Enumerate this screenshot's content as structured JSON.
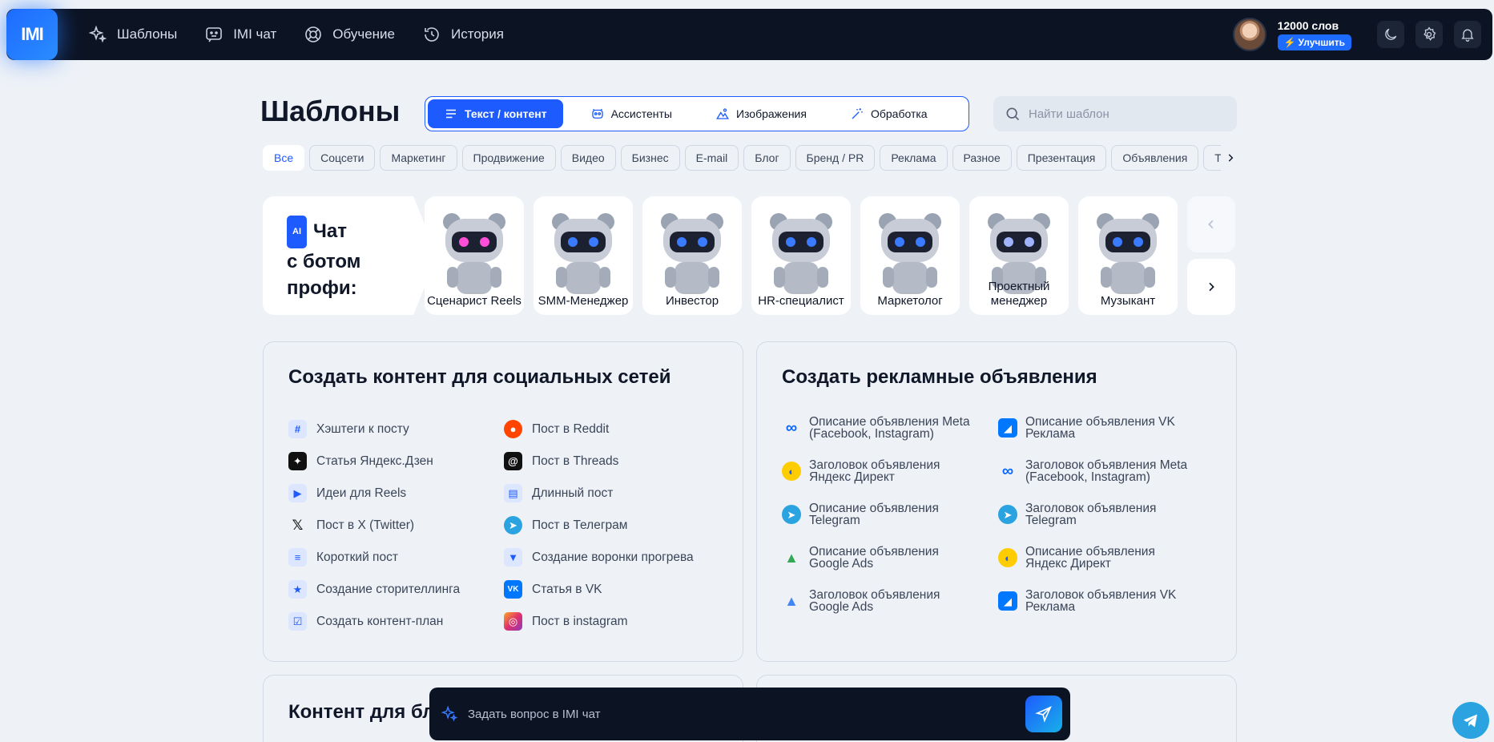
{
  "topbar": {
    "logo": "IMI",
    "nav": [
      {
        "label": "Шаблоны",
        "icon": "sparkles-icon"
      },
      {
        "label": "IMI чат",
        "icon": "chat-bot-icon"
      },
      {
        "label": "Обучение",
        "icon": "lifebuoy-icon"
      },
      {
        "label": "История",
        "icon": "history-icon"
      }
    ],
    "words": "12000 слов",
    "upgrade": "Улучшить"
  },
  "page": {
    "title": "Шаблоны",
    "type_tabs": [
      "Текст / контент",
      "Ассистенты",
      "Изображения",
      "Обработка"
    ],
    "search_placeholder": "Найти шаблон"
  },
  "chips": [
    "Все",
    "Соцсети",
    "Маркетинг",
    "Продвижение",
    "Видео",
    "Бизнес",
    "E-mail",
    "Блог",
    "Бренд / PR",
    "Реклама",
    "Разное",
    "Презентация",
    "Объявления",
    "То"
  ],
  "bots": {
    "badge": "AI",
    "promo": [
      "Чат",
      "с ботом",
      "профи:"
    ],
    "items": [
      {
        "name": "Сценарист Reels",
        "eye": "#ff4fd8"
      },
      {
        "name": "SMM-Менеджер",
        "eye": "#3a7bff"
      },
      {
        "name": "Инвестор",
        "eye": "#3a7bff"
      },
      {
        "name": "HR-специалист",
        "eye": "#3a7bff"
      },
      {
        "name": "Маркетолог",
        "eye": "#3a7bff"
      },
      {
        "name": "Проектный менеджер",
        "eye": "#9fb3ff"
      },
      {
        "name": "Музыкант",
        "eye": "#3a7bff"
      }
    ]
  },
  "social": {
    "title": "Создать контент для социальных сетей",
    "left": [
      {
        "label": "Хэштеги к посту",
        "icon": "hashtag-icon"
      },
      {
        "label": "Статья Яндекс.Дзен",
        "icon": "dzen-icon"
      },
      {
        "label": "Идеи для Reels",
        "icon": "reels-icon"
      },
      {
        "label": "Пост в X (Twitter)",
        "icon": "x-twitter-icon"
      },
      {
        "label": "Короткий пост",
        "icon": "short-post-icon"
      },
      {
        "label": "Создание сторителлинга",
        "icon": "star-bookmark-icon"
      },
      {
        "label": "Создать контент-план",
        "icon": "checklist-icon"
      }
    ],
    "right": [
      {
        "label": "Пост в Reddit",
        "icon": "reddit-icon"
      },
      {
        "label": "Пост в Threads",
        "icon": "threads-icon"
      },
      {
        "label": "Длинный пост",
        "icon": "long-post-icon"
      },
      {
        "label": "Пост в Телеграм",
        "icon": "telegram-icon"
      },
      {
        "label": "Создание воронки прогрева",
        "icon": "funnel-icon"
      },
      {
        "label": "Статья в VK",
        "icon": "vk-icon"
      },
      {
        "label": "Пост в instagram",
        "icon": "instagram-icon"
      }
    ]
  },
  "ads": {
    "title": "Создать рекламные объявления",
    "left": [
      {
        "label": "Описание объявления Meta (Facebook, Instagram)",
        "icon": "meta-icon"
      },
      {
        "label": "Заголовок объявления Яндекс Директ",
        "icon": "yandex-direct-icon"
      },
      {
        "label": "Описание объявления Telegram",
        "icon": "telegram-icon"
      },
      {
        "label": "Описание объявления Google Ads",
        "icon": "google-ads-icon"
      },
      {
        "label": "Заголовок объявления Google Ads",
        "icon": "google-ads-icon"
      }
    ],
    "right": [
      {
        "label": "Описание объявления VK Реклама",
        "icon": "vk-ads-icon"
      },
      {
        "label": "Заголовок объявления Meta (Facebook, Instagram)",
        "icon": "meta-icon"
      },
      {
        "label": "Заголовок объявления Telegram",
        "icon": "telegram-icon"
      },
      {
        "label": "Описание объявления Яндекс Директ",
        "icon": "yandex-direct-icon"
      },
      {
        "label": "Заголовок объявления VK Реклама",
        "icon": "vk-ads-icon"
      }
    ]
  },
  "bottom": {
    "left_title": "Контент для бл"
  },
  "chat": {
    "placeholder": "Задать вопрос в IMI чат"
  },
  "colors": {
    "accent": "#1e5bff",
    "dark": "#0c1424",
    "bg": "#eef2f7"
  }
}
